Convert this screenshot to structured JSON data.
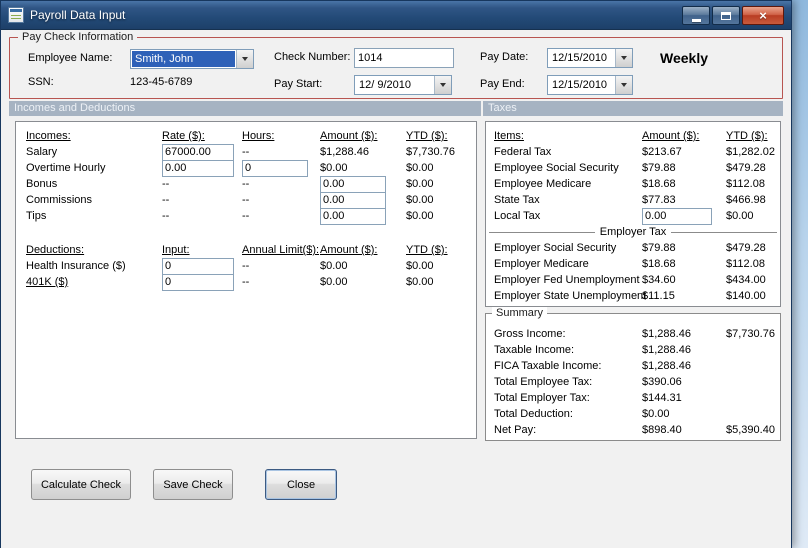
{
  "window": {
    "title": "Payroll Data Input",
    "close_glyph": "×"
  },
  "paycheck": {
    "group_title": "Pay Check Information",
    "employee_name": {
      "label": "Employee Name:",
      "value": "Smith, John"
    },
    "ssn": {
      "label": "SSN:",
      "value": "123-45-6789"
    },
    "check_number": {
      "label": "Check Number:",
      "value": "1014"
    },
    "pay_start": {
      "label": "Pay Start:",
      "value": "12/ 9/2010"
    },
    "pay_date": {
      "label": "Pay Date:",
      "value": "12/15/2010"
    },
    "pay_end": {
      "label": "Pay End:",
      "value": "12/15/2010"
    },
    "frequency": "Weekly"
  },
  "bands": {
    "left": "Incomes and Deductions",
    "right": "Taxes"
  },
  "incomes": {
    "headers": {
      "name": "Incomes:",
      "rate": "Rate ($):",
      "hours": "Hours:",
      "amount": "Amount ($):",
      "ytd": "YTD ($):"
    },
    "rows": [
      {
        "name": "Salary",
        "rate": "67000.00",
        "hours": "--",
        "amount": "$1,288.46",
        "ytd": "$7,730.76"
      },
      {
        "name": "Overtime Hourly",
        "rate": "0.00",
        "hours": "0",
        "amount": "$0.00",
        "ytd": "$0.00"
      },
      {
        "name": "Bonus",
        "rate": "--",
        "hours": "--",
        "amount": "0.00",
        "ytd": "$0.00"
      },
      {
        "name": "Commissions",
        "rate": "--",
        "hours": "--",
        "amount": "0.00",
        "ytd": "$0.00"
      },
      {
        "name": "Tips",
        "rate": "--",
        "hours": "--",
        "amount": "0.00",
        "ytd": "$0.00"
      }
    ]
  },
  "deductions": {
    "headers": {
      "name": "Deductions:",
      "input": "Input:",
      "limit": "Annual Limit($):",
      "amount": "Amount ($):",
      "ytd": "YTD ($):"
    },
    "rows": [
      {
        "name": "Health Insurance ($)",
        "input": "0",
        "limit": "--",
        "amount": "$0.00",
        "ytd": "$0.00"
      },
      {
        "name": "401K ($)",
        "input": "0",
        "limit": "--",
        "amount": "$0.00",
        "ytd": "$0.00"
      }
    ]
  },
  "taxes": {
    "headers": {
      "item": "Items:",
      "amount": "Amount ($):",
      "ytd": "YTD ($):"
    },
    "employee_rows": [
      {
        "item": "Federal Tax",
        "amount": "$213.67",
        "ytd": "$1,282.02"
      },
      {
        "item": "Employee Social Security",
        "amount": "$79.88",
        "ytd": "$479.28"
      },
      {
        "item": "Employee Medicare",
        "amount": "$18.68",
        "ytd": "$112.08"
      },
      {
        "item": "State Tax",
        "amount": "$77.83",
        "ytd": "$466.98"
      },
      {
        "item": "Local Tax",
        "amount": "0.00",
        "ytd": "$0.00"
      }
    ],
    "employer_divider": "Employer Tax",
    "employer_rows": [
      {
        "item": "Employer Social Security",
        "amount": "$79.88",
        "ytd": "$479.28"
      },
      {
        "item": "Employer Medicare",
        "amount": "$18.68",
        "ytd": "$112.08"
      },
      {
        "item": "Employer Fed Unemployment",
        "amount": "$34.60",
        "ytd": "$434.00"
      },
      {
        "item": "Employer State Unemployment",
        "amount": "$11.15",
        "ytd": "$140.00"
      }
    ]
  },
  "summary": {
    "group_title": "Summary",
    "rows": [
      {
        "label": "Gross Income:",
        "amount": "$1,288.46",
        "ytd": "$7,730.76"
      },
      {
        "label": "Taxable Income:",
        "amount": "$1,288.46",
        "ytd": ""
      },
      {
        "label": "FICA Taxable Income:",
        "amount": "$1,288.46",
        "ytd": ""
      },
      {
        "label": "Total Employee Tax:",
        "amount": "$390.06",
        "ytd": ""
      },
      {
        "label": "Total Employer Tax:",
        "amount": "$144.31",
        "ytd": ""
      },
      {
        "label": "Total Deduction:",
        "amount": "$0.00",
        "ytd": ""
      },
      {
        "label": "Net Pay:",
        "amount": "$898.40",
        "ytd": "$5,390.40"
      }
    ]
  },
  "buttons": {
    "calculate": "Calculate Check",
    "save": "Save Check",
    "close": "Close"
  },
  "colors": {
    "titlebar": "#234a77",
    "group_border_red": "#b85551",
    "band_bg": "#a6b3c2",
    "selection_blue": "#2e61b8"
  }
}
